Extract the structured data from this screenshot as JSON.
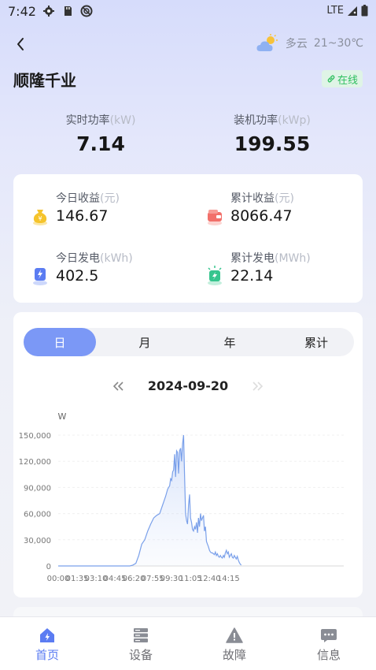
{
  "status_bar": {
    "time": "7:42",
    "network": "LTE"
  },
  "header": {
    "weather": {
      "condition": "多云",
      "temperature": "21~30℃"
    },
    "plant_name": "顺隆千业",
    "online_status": "在线"
  },
  "power": {
    "realtime": {
      "label": "实时功率",
      "unit": "(kW)",
      "value": "7.14"
    },
    "installed": {
      "label": "装机功率",
      "unit": "(kWp)",
      "value": "199.55"
    }
  },
  "stats": [
    {
      "label": "今日收益",
      "unit": "(元)",
      "value": "146.67",
      "icon": "money-bag-icon",
      "color": "#f5c42c"
    },
    {
      "label": "累计收益",
      "unit": "(元)",
      "value": "8066.47",
      "icon": "wallet-icon",
      "color": "#f2706a"
    },
    {
      "label": "今日发电",
      "unit": "(kWh)",
      "value": "402.5",
      "icon": "electric-meter-icon",
      "color": "#5b7cf2"
    },
    {
      "label": "累计发电",
      "unit": "(MWh)",
      "value": "22.14",
      "icon": "charging-station-icon",
      "color": "#37c58e"
    }
  ],
  "period_tabs": {
    "items": [
      "日",
      "月",
      "年",
      "累计"
    ],
    "active_index": 0
  },
  "date_nav": {
    "date": "2024-09-20"
  },
  "chart_data": {
    "type": "area",
    "ylabel": "W",
    "ylim": [
      0,
      150000
    ],
    "yticks": [
      "0",
      "30,000",
      "60,000",
      "90,000",
      "120,000",
      "150,000"
    ],
    "xlim": [
      0,
      1435
    ],
    "xticks": [
      "00:00",
      "01:35",
      "03:10",
      "04:45",
      "06:20",
      "07:55",
      "09:30",
      "11:05",
      "12:40",
      "14:15"
    ],
    "series": [
      {
        "color": "#7aa0ea",
        "x": [
          0,
          360,
          375,
          390,
          405,
          420,
          435,
          450,
          465,
          480,
          495,
          510,
          525,
          540,
          550,
          560,
          565,
          570,
          575,
          580,
          585,
          590,
          595,
          600,
          605,
          610,
          615,
          620,
          625,
          630,
          635,
          640,
          645,
          650,
          655,
          660,
          665,
          670,
          675,
          680,
          685,
          690,
          695,
          700,
          705,
          710,
          715,
          720,
          725,
          730,
          735,
          740,
          745,
          750,
          755,
          760,
          765,
          770,
          775,
          780,
          785,
          790,
          795,
          800,
          805,
          810,
          815,
          820,
          825,
          830,
          835,
          840,
          845,
          850,
          855,
          860,
          865,
          870,
          875,
          880,
          885,
          890,
          895,
          900,
          905,
          910,
          915,
          920
        ],
        "values": [
          0,
          0,
          1000,
          3000,
          12000,
          25000,
          30000,
          40000,
          48000,
          55000,
          58000,
          60000,
          70000,
          80000,
          88000,
          92000,
          100000,
          98000,
          108000,
          110000,
          128000,
          102000,
          132000,
          130000,
          106000,
          132000,
          135000,
          120000,
          140000,
          150000,
          105000,
          60000,
          52000,
          48000,
          70000,
          82000,
          55000,
          50000,
          42000,
          40000,
          45000,
          42000,
          50000,
          38000,
          55000,
          45000,
          60000,
          52000,
          55000,
          58000,
          40000,
          45000,
          28000,
          25000,
          22000,
          18000,
          16000,
          15000,
          15000,
          14000,
          13000,
          16000,
          12000,
          14000,
          11000,
          10000,
          12000,
          10000,
          9000,
          12000,
          10000,
          15000,
          18000,
          14000,
          16000,
          10000,
          12000,
          14000,
          10000,
          9000,
          12000,
          10000,
          8000,
          11000,
          7000,
          4000,
          2000,
          1000
        ]
      }
    ]
  },
  "tabbar": {
    "items": [
      {
        "label": "首页",
        "icon": "home-icon"
      },
      {
        "label": "设备",
        "icon": "device-icon"
      },
      {
        "label": "故障",
        "icon": "warning-icon"
      },
      {
        "label": "信息",
        "icon": "message-icon"
      }
    ],
    "active_index": 0,
    "active_color": "#5b7cf2"
  }
}
